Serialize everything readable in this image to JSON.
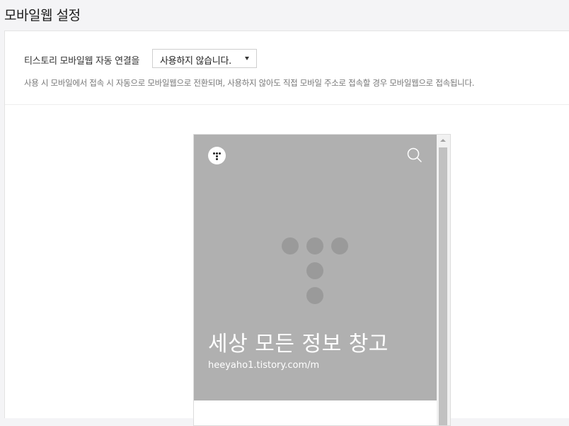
{
  "page": {
    "title": "모바일웹 설정"
  },
  "setting": {
    "label": "티스토리 모바일웹 자동 연결을",
    "select_value": "사용하지 않습니다.",
    "description": "사용 시 모바일에서 접속 시 자동으로 모바일웹으로 전환되며, 사용하지 않아도 직접 모바일 주소로 접속할 경우 모바일웹으로 접속됩니다."
  },
  "preview": {
    "blog_title": "세상 모든 정보 창고",
    "blog_url": "heeyaho1.tistory.com/m",
    "hero_color": "#b0b0b0",
    "icons": [
      "tistory-logo-icon",
      "search-icon"
    ]
  }
}
